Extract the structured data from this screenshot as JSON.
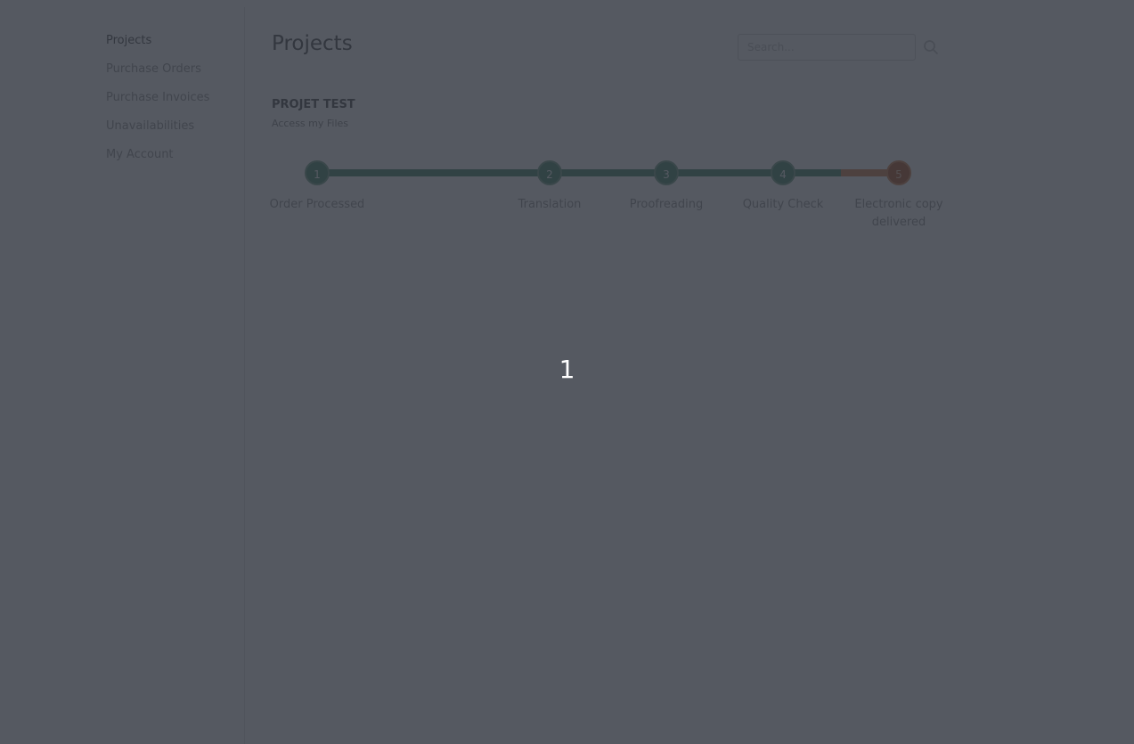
{
  "sidebar": {
    "items": [
      {
        "label": "Projects",
        "active": true
      },
      {
        "label": "Purchase Orders",
        "active": false
      },
      {
        "label": "Purchase Invoices",
        "active": false
      },
      {
        "label": "Unavailabilities",
        "active": false
      },
      {
        "label": "My Account",
        "active": false
      }
    ]
  },
  "header": {
    "title": "Projects",
    "search_placeholder": "Search...",
    "search_icon": "search-icon"
  },
  "project": {
    "name": "PROJET TEST",
    "files_link": "Access my Files",
    "steps": [
      {
        "number": "1",
        "label": "Order Processed",
        "status": "done"
      },
      {
        "number": "2",
        "label": "Translation",
        "status": "done"
      },
      {
        "number": "3",
        "label": "Proofreading",
        "status": "done"
      },
      {
        "number": "4",
        "label": "Quality Check",
        "status": "done"
      },
      {
        "number": "5",
        "label": "Electronic copy delivered",
        "status": "pending"
      }
    ]
  },
  "overlay": {
    "number": "1"
  },
  "colors": {
    "step_done": "#4a8a6e",
    "step_pending": "#d48654",
    "overlay": "#2a303a"
  }
}
